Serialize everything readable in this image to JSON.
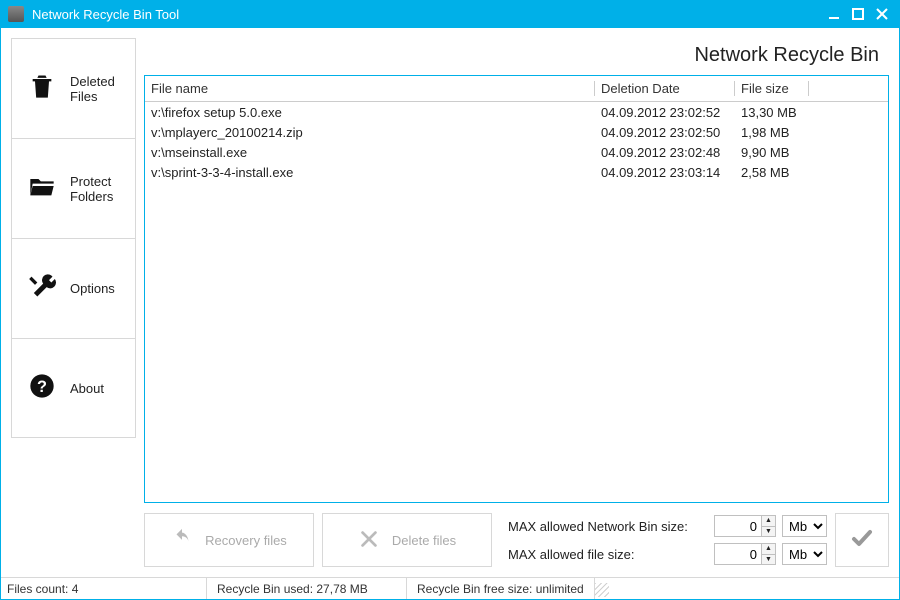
{
  "window": {
    "title": "Network Recycle Bin Tool"
  },
  "sidebar": {
    "items": [
      {
        "label": "Deleted Files",
        "icon": "trash-icon"
      },
      {
        "label": "Protect Folders",
        "icon": "folder-open-icon"
      },
      {
        "label": "Options",
        "icon": "tools-icon"
      },
      {
        "label": "About",
        "icon": "question-icon"
      }
    ],
    "selected_index": 0
  },
  "page": {
    "title": "Network Recycle Bin"
  },
  "table": {
    "columns": {
      "name": "File name",
      "date": "Deletion Date",
      "size": "File size"
    },
    "rows": [
      {
        "name": "v:\\firefox setup 5.0.exe",
        "date": "04.09.2012 23:02:52",
        "size": "13,30 MB"
      },
      {
        "name": "v:\\mplayerc_20100214.zip",
        "date": "04.09.2012 23:02:50",
        "size": "1,98 MB"
      },
      {
        "name": "v:\\mseinstall.exe",
        "date": "04.09.2012 23:02:48",
        "size": "9,90 MB"
      },
      {
        "name": "v:\\sprint-3-3-4-install.exe",
        "date": "04.09.2012 23:03:14",
        "size": "2,58 MB"
      }
    ]
  },
  "toolbar": {
    "recovery_label": "Recovery files",
    "delete_label": "Delete files",
    "max_bin_label": "MAX allowed Network Bin size:",
    "max_file_label": "MAX allowed file size:",
    "max_bin_value": "0",
    "max_file_value": "0",
    "unit_options": [
      "Mb"
    ],
    "unit_selected": "Mb"
  },
  "status": {
    "files_count_label": "Files count: 4",
    "used_label": "Recycle Bin used: 27,78 MB",
    "free_label": "Recycle Bin free size: unlimited"
  },
  "colors": {
    "accent": "#00b0e8"
  }
}
